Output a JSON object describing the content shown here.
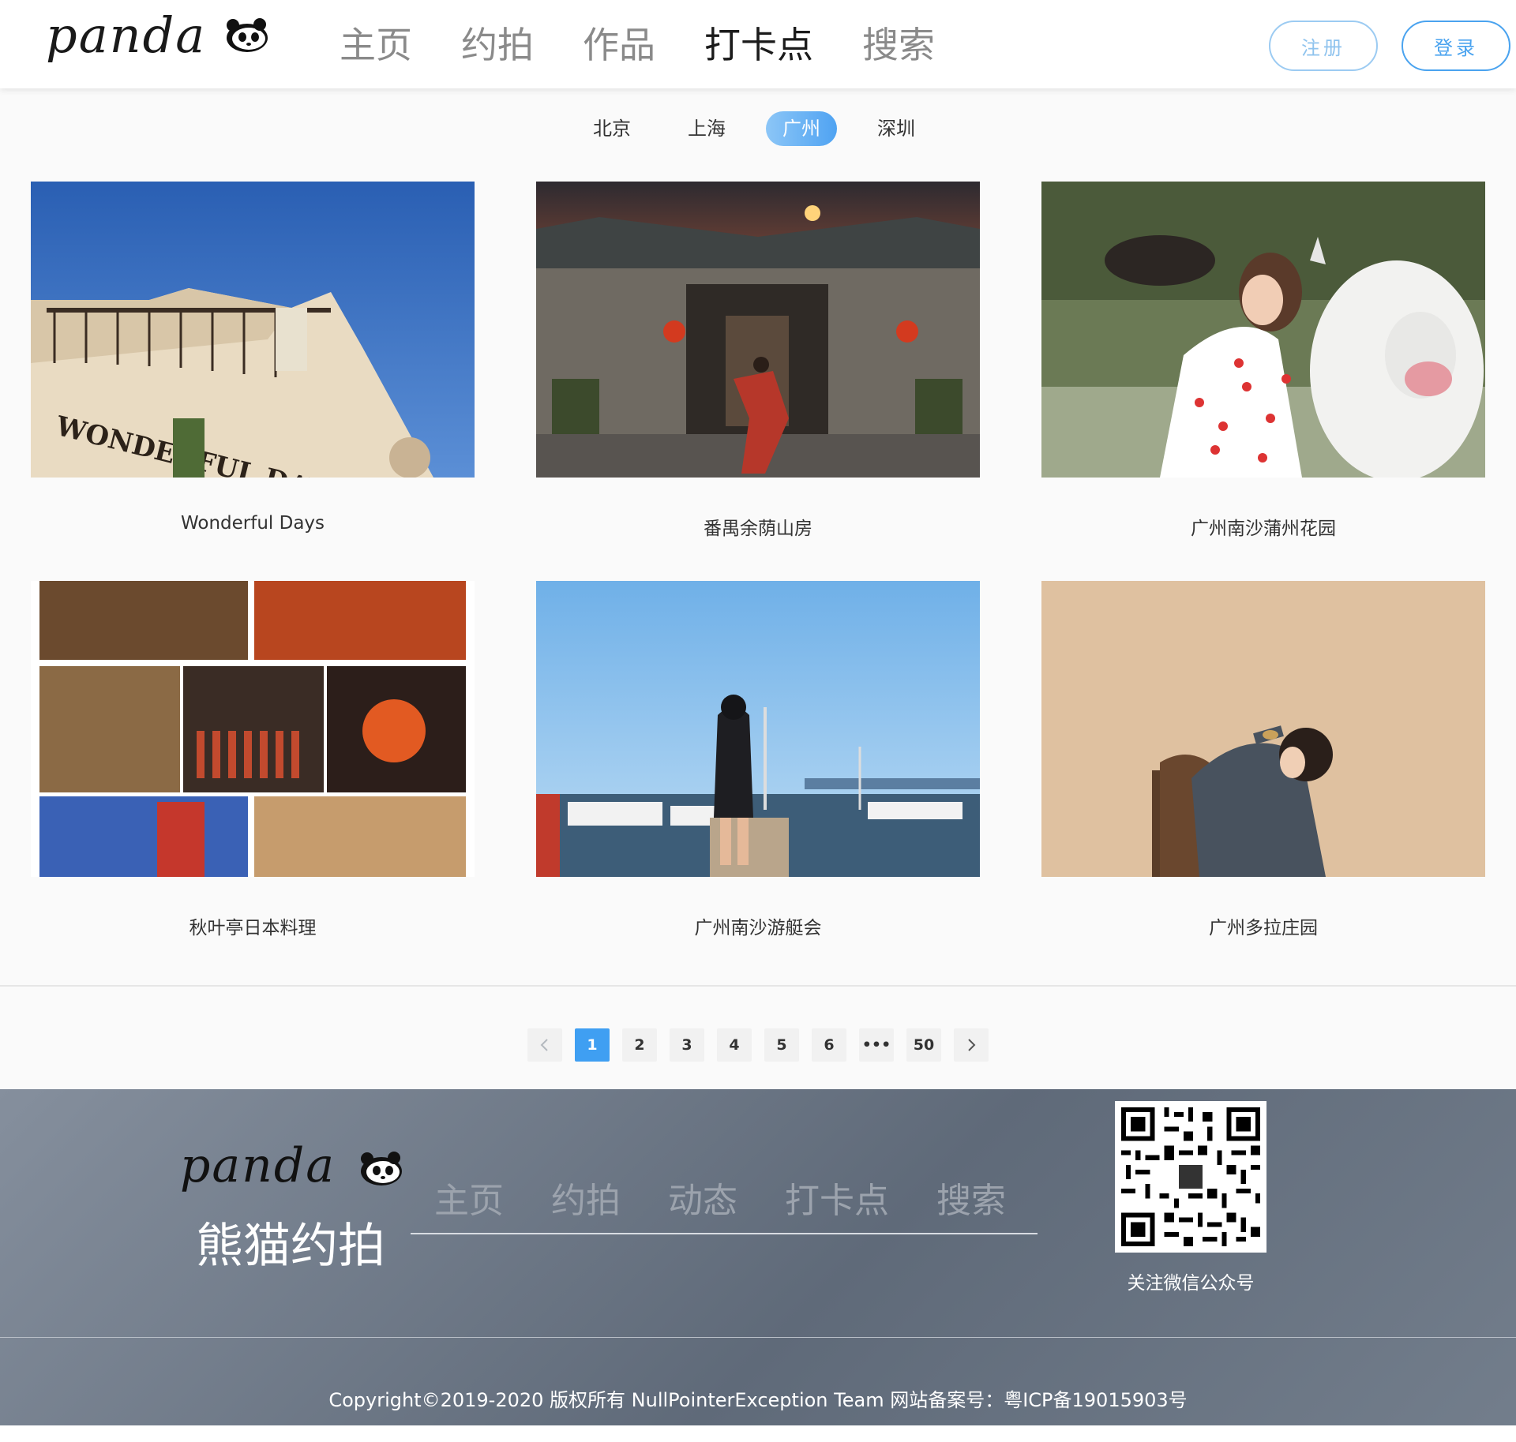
{
  "header": {
    "logo_text": "panda",
    "nav": [
      {
        "label": "主页",
        "active": false
      },
      {
        "label": "约拍",
        "active": false
      },
      {
        "label": "作品",
        "active": false
      },
      {
        "label": "打卡点",
        "active": true
      },
      {
        "label": "搜索",
        "active": false
      }
    ],
    "register_label": "注册",
    "login_label": "登录"
  },
  "city_tabs": [
    {
      "label": "北京",
      "active": false
    },
    {
      "label": "上海",
      "active": false
    },
    {
      "label": "广州",
      "active": true
    },
    {
      "label": "深圳",
      "active": false
    }
  ],
  "spots": [
    {
      "title": "Wonderful Days",
      "image": "cafe-building-blue-sky-photo"
    },
    {
      "title": "番禺余荫山房",
      "image": "ancient-temple-dancer-photo"
    },
    {
      "title": "广州南沙蒲州花园",
      "image": "girl-with-cow-statue-photo"
    },
    {
      "title": "秋叶亭日本料理",
      "image": "japanese-restaurant-collage-photo"
    },
    {
      "title": "广州南沙游艇会",
      "image": "girl-at-yacht-marina-photo"
    },
    {
      "title": "广州多拉庄园",
      "image": "girl-with-mirror-photo"
    }
  ],
  "pagination": {
    "prev_icon": "chevron-left-icon",
    "pages": [
      "1",
      "2",
      "3",
      "4",
      "5",
      "6",
      "•••",
      "50"
    ],
    "current": "1",
    "next_icon": "chevron-right-icon"
  },
  "footer": {
    "logo_text": "panda",
    "brand_name": "熊猫约拍",
    "nav": [
      "主页",
      "约拍",
      "动态",
      "打卡点",
      "搜索"
    ],
    "qr_caption": "关注微信公众号",
    "copyright": "Copyright©2019-2020 版权所有 NullPointerException Team 网站备案号：粤ICP备19015903号"
  },
  "colors": {
    "accent": "#3f9ff2",
    "footer_bg": "#6b7684"
  }
}
